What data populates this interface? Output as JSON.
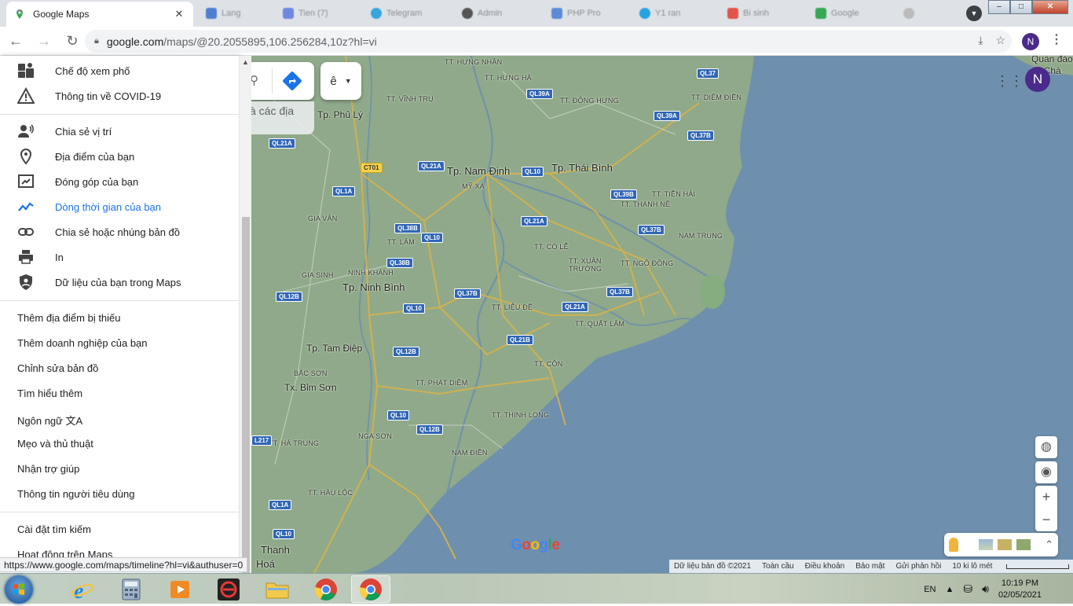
{
  "browser": {
    "tab_title": "Google Maps",
    "faded_tabs": [
      "Lang",
      "Tien (7)",
      "Telegram",
      "Admin",
      "PHP Pro",
      "Y1 ran",
      "Bi sinh",
      "Google"
    ],
    "url_host": "google.com",
    "url_rest": "/maps/@20.2055895,106.256284,10z?hl=vi",
    "profile_initial": "N"
  },
  "menu": {
    "top_items": [
      {
        "icon": "street-view-icon",
        "label": "Chế độ xem phố"
      },
      {
        "icon": "warning-icon",
        "label": "Thông tin về COVID-19"
      }
    ],
    "icon_items": [
      {
        "icon": "share-location-icon",
        "label": "Chia sẻ vị trí"
      },
      {
        "icon": "place-pin-icon",
        "label": "Địa điểm của bạn"
      },
      {
        "icon": "contribution-icon",
        "label": "Đóng góp của bạn"
      },
      {
        "icon": "timeline-icon",
        "label": "Dòng thời gian của bạn"
      },
      {
        "icon": "link-icon",
        "label": "Chia sẻ hoặc nhúng bản đồ"
      },
      {
        "icon": "print-icon",
        "label": "In"
      },
      {
        "icon": "shield-data-icon",
        "label": "Dữ liệu của bạn trong Maps"
      }
    ],
    "text_items": [
      "Thêm địa điểm bị thiếu",
      "Thêm doanh nghiệp của bạn",
      "Chỉnh sửa bản đồ",
      "Tìm hiểu thêm",
      "Ngôn ngữ",
      "Mẹo và thủ thuật",
      "Nhận trợ giúp",
      "Thông tin người tiêu dùng"
    ],
    "bottom_items": [
      "Cài đặt tìm kiếm",
      "Hoạt động trên Maps"
    ]
  },
  "status_url": "https://www.google.com/maps/timeline?hl=vi&authuser=0",
  "map": {
    "search_hint": "à các địa",
    "lang_letter": "ê",
    "user_initial": "N",
    "logo": "Google",
    "places_big": [
      "Tp. Nam Định",
      "Tp. Thái Bình",
      "Tp. Ninh Bình",
      "Tp. Phủ Lý",
      "Tp. Tam Điệp",
      "Tx. Bỉm Sơn",
      "Thanh",
      "Hoá",
      "Quần đảo",
      "ng Chà"
    ],
    "places_small": [
      "TT. HƯNG NHÂN",
      "TT. HƯNG HÀ",
      "TT. VĨNH TRỤ",
      "TT. ĐÔNG HƯNG",
      "TT. DIÊM ĐIỀN",
      "MỸ XÁ",
      "TT. TIỀN HẢI",
      "TT. THANH NÊ",
      "GIA VÂN",
      "TT. LÂM",
      "NAM TRUNG",
      "TT. CÓ LỄ",
      "TT. XUÂN",
      "TRƯỜNG",
      "TT. NGÔ ĐỒNG",
      "NINH KHÁNH",
      "GIA SINH",
      "TT. LIỄU ĐỀ",
      "TT. QUẤT LÂM",
      "BẮC SƠN",
      "TT. CỒN",
      "TT. PHÁT DIỆM",
      "TT. THỊNH LONG",
      "NGA SƠN",
      "TT. HÀ TRUNG",
      "NAM ĐIỀN",
      "TT. HẬU LỘC"
    ],
    "shields": [
      "QL37",
      "QL39A",
      "QL39A",
      "QL37B",
      "QL21A",
      "QL21A",
      "CT01",
      "QL10",
      "QL1A",
      "QL39B",
      "QL38B",
      "QL10",
      "QL21A",
      "QL37B",
      "QL38B",
      "QL12B",
      "QL37B",
      "QL10",
      "QL21A",
      "QL37B",
      "QL21B",
      "QL12B",
      "QL10",
      "QL12B",
      "L217",
      "QL1A",
      "QL10"
    ],
    "footer": [
      "Dữ liệu bản đồ ©2021",
      "Toàn cầu",
      "Điều khoản",
      "Bảo mật",
      "Gửi phản hồi",
      "10 ki lô mét"
    ]
  },
  "taskbar": {
    "lang": "EN",
    "time": "10:19 PM",
    "date": "02/05/2021"
  }
}
